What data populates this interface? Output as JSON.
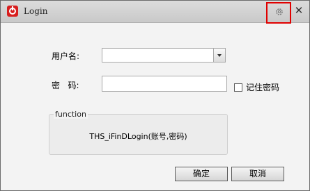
{
  "window": {
    "title": "Login"
  },
  "form": {
    "username_label": "用户名:",
    "username_value": "",
    "password_label": "密   码:",
    "password_value": "",
    "remember_label": "记住密码",
    "remember_checked": false
  },
  "function_group": {
    "title": "function",
    "text": "THS_iFinDLogin(账号,密码)"
  },
  "buttons": {
    "ok": "确定",
    "cancel": "取消"
  },
  "icons": {
    "app": "app-logo-icon",
    "settings": "gear-icon",
    "close": "close-icon",
    "dropdown": "chevron-down-icon"
  },
  "colors": {
    "highlight": "#e00000",
    "app_icon": "#d81e1e"
  }
}
